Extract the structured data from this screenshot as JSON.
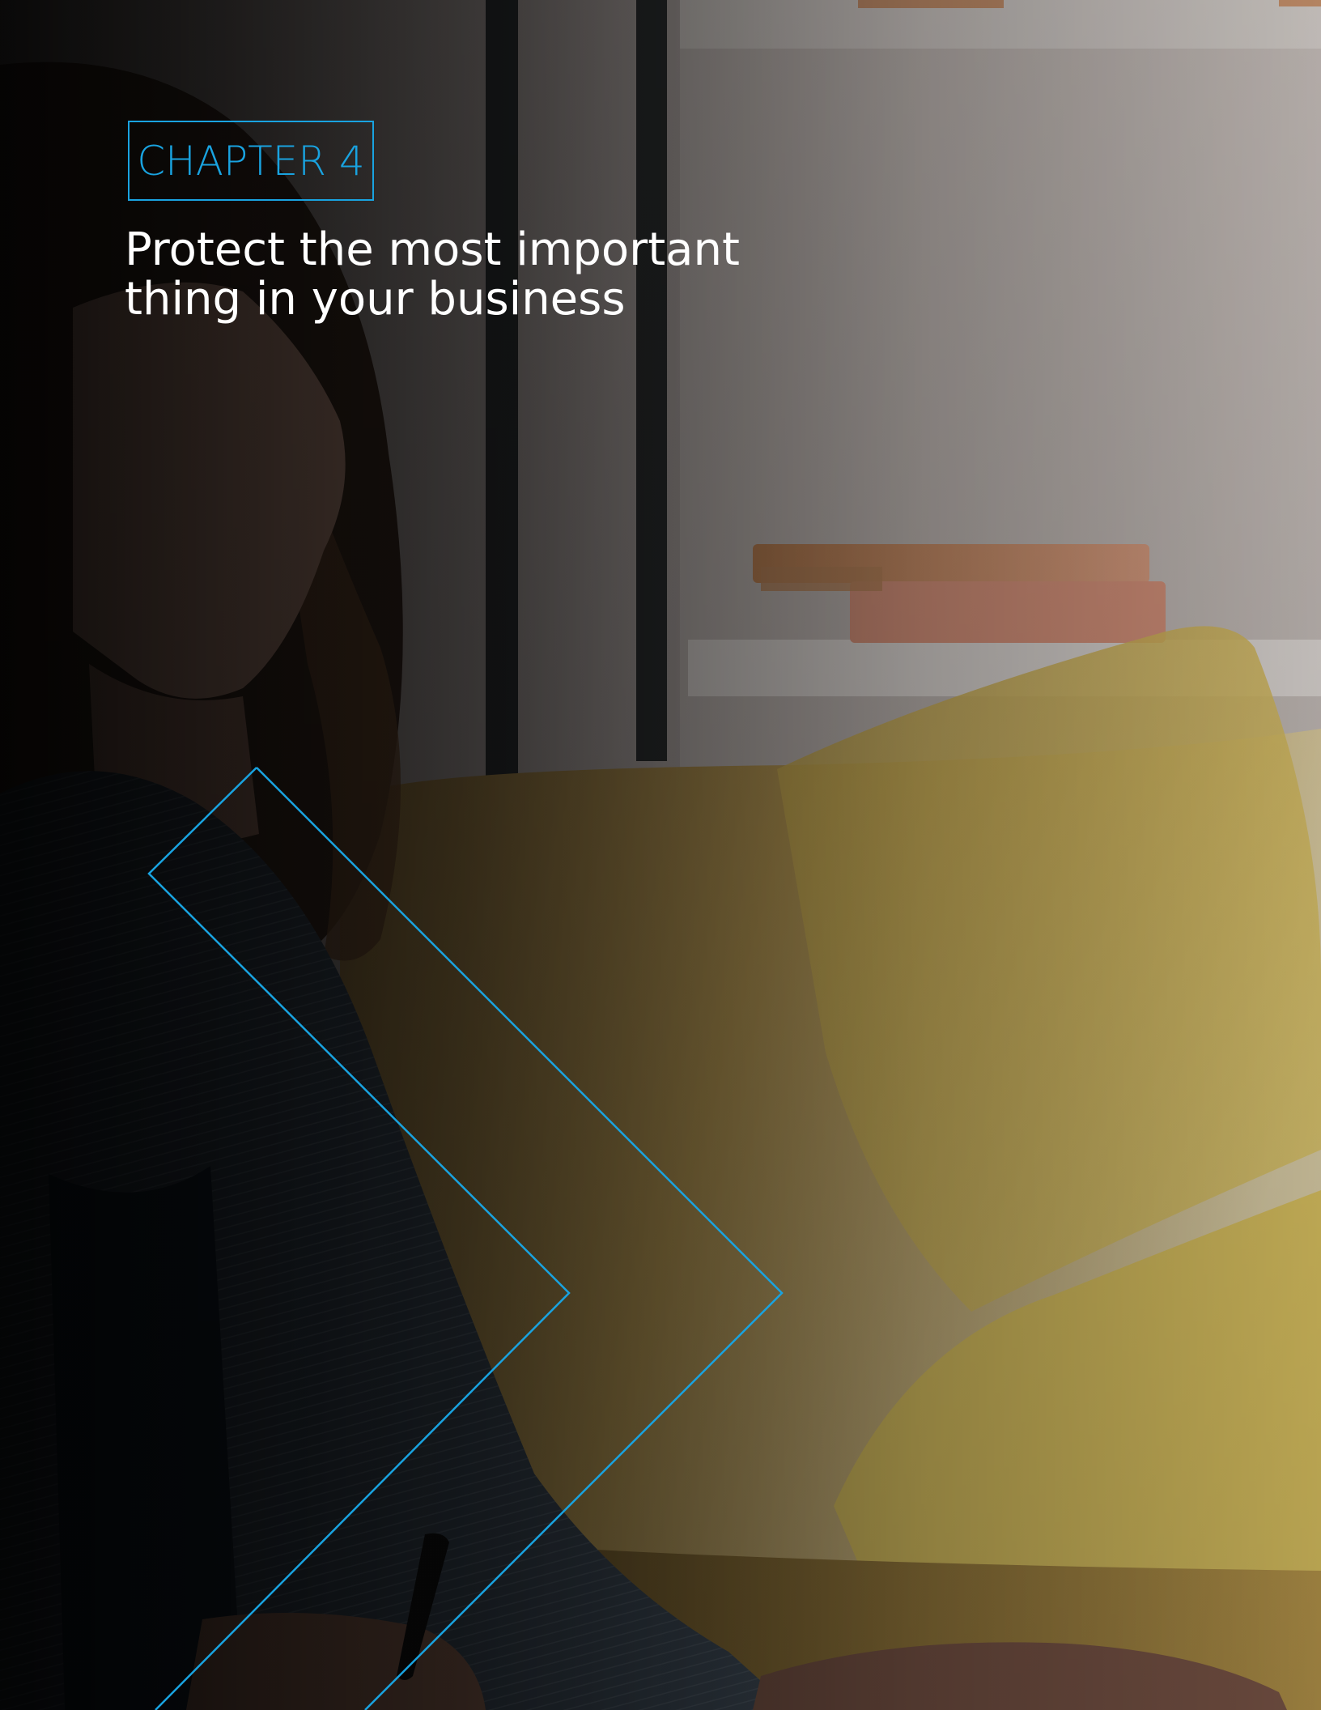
{
  "chapter": {
    "label": "CHAPTER 4"
  },
  "title": {
    "line1": "Protect the most important",
    "line2": "thing in your business"
  },
  "colors": {
    "accent": "#19a3e0",
    "title_text": "#ffffff",
    "overlay_dark": "#000000",
    "sofa_yellow": "#e8c75a"
  },
  "background_image": "photo-woman-on-yellow-sofa"
}
